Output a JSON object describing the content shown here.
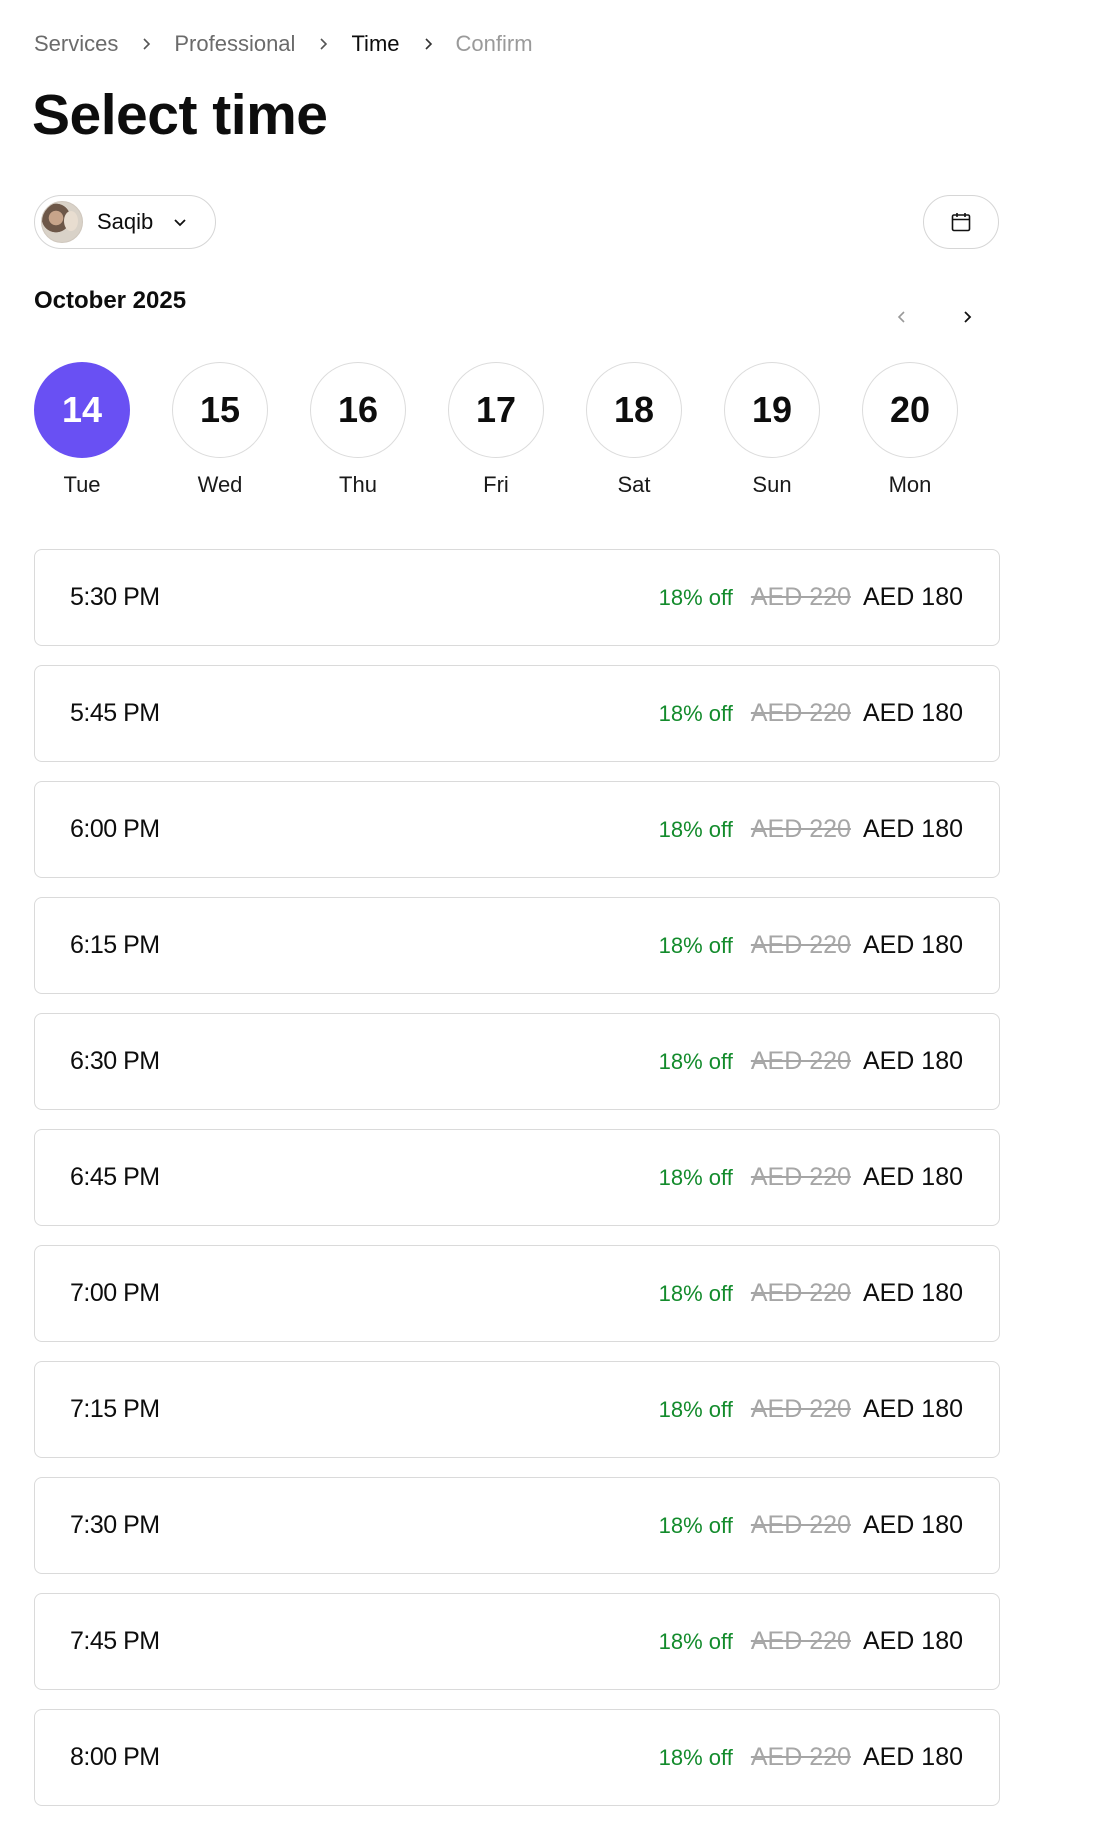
{
  "breadcrumb": {
    "items": [
      "Services",
      "Professional",
      "Time",
      "Confirm"
    ]
  },
  "page": {
    "title": "Select time"
  },
  "staff": {
    "name": "Saqib"
  },
  "calendar": {
    "month_label": "October 2025",
    "days": [
      {
        "num": "14",
        "label": "Tue",
        "selected": true
      },
      {
        "num": "15",
        "label": "Wed"
      },
      {
        "num": "16",
        "label": "Thu"
      },
      {
        "num": "17",
        "label": "Fri"
      },
      {
        "num": "18",
        "label": "Sat"
      },
      {
        "num": "19",
        "label": "Sun"
      },
      {
        "num": "20",
        "label": "Mon"
      }
    ]
  },
  "slots": [
    {
      "time": "5:30 PM",
      "discount": "18% off",
      "old_price": "AED 220",
      "price": "AED 180"
    },
    {
      "time": "5:45 PM",
      "discount": "18% off",
      "old_price": "AED 220",
      "price": "AED 180"
    },
    {
      "time": "6:00 PM",
      "discount": "18% off",
      "old_price": "AED 220",
      "price": "AED 180"
    },
    {
      "time": "6:15 PM",
      "discount": "18% off",
      "old_price": "AED 220",
      "price": "AED 180"
    },
    {
      "time": "6:30 PM",
      "discount": "18% off",
      "old_price": "AED 220",
      "price": "AED 180"
    },
    {
      "time": "6:45 PM",
      "discount": "18% off",
      "old_price": "AED 220",
      "price": "AED 180"
    },
    {
      "time": "7:00 PM",
      "discount": "18% off",
      "old_price": "AED 220",
      "price": "AED 180"
    },
    {
      "time": "7:15 PM",
      "discount": "18% off",
      "old_price": "AED 220",
      "price": "AED 180"
    },
    {
      "time": "7:30 PM",
      "discount": "18% off",
      "old_price": "AED 220",
      "price": "AED 180"
    },
    {
      "time": "7:45 PM",
      "discount": "18% off",
      "old_price": "AED 220",
      "price": "AED 180"
    },
    {
      "time": "8:00 PM",
      "discount": "18% off",
      "old_price": "AED 220",
      "price": "AED 180"
    }
  ],
  "icons": {
    "staff_dropdown": "chevron-down-icon",
    "calendar": "calendar-icon",
    "prev": "chevron-left-icon",
    "next": "chevron-right-icon",
    "breadcrumb_separator": "chevron-right-icon"
  },
  "colors": {
    "accent": "#6950f3",
    "discount": "#138b2c",
    "strikethrough": "#a6a6a6",
    "border": "#dadada"
  }
}
